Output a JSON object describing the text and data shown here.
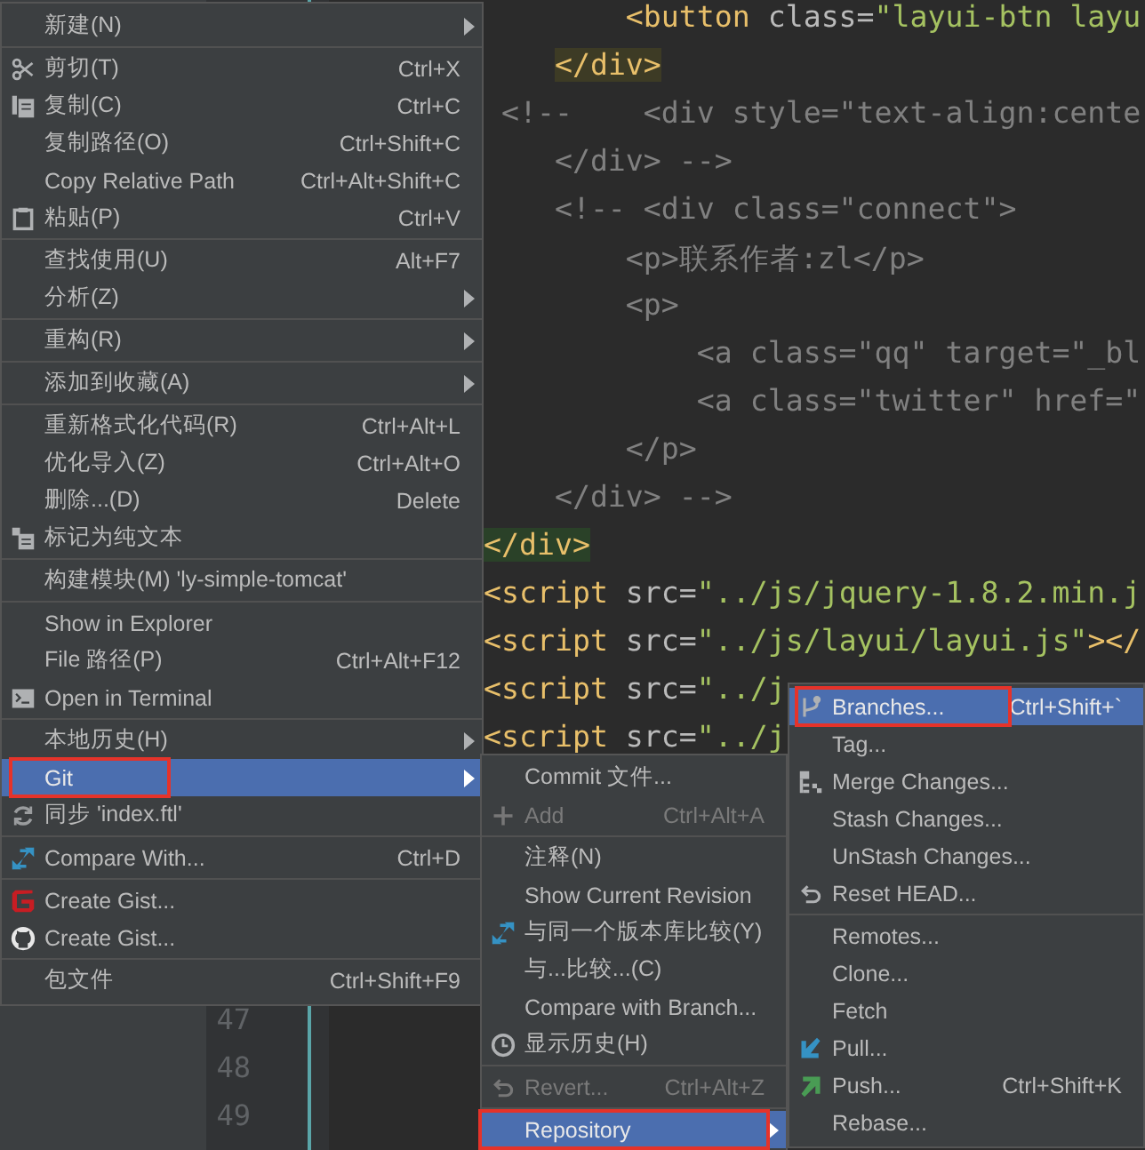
{
  "editor": {
    "code_lines": [
      {
        "tokens": [
          {
            "kind": "tag",
            "text": "        <button"
          },
          {
            "kind": "attr",
            "text": " class="
          },
          {
            "kind": "str",
            "text": "\"layui-btn layu"
          }
        ]
      },
      {
        "tokens": [
          {
            "kind": "matched-tag",
            "text": "    </div>"
          }
        ]
      },
      {
        "tokens": [
          {
            "kind": "comment",
            "text": " <!--    <div style=\"text-align:cente"
          }
        ]
      },
      {
        "tokens": [
          {
            "kind": "comment",
            "text": "    </div> -->"
          }
        ]
      },
      {
        "tokens": [
          {
            "kind": "comment",
            "text": "    <!-- <div class=\"connect\">"
          }
        ]
      },
      {
        "tokens": [
          {
            "kind": "comment",
            "text": "        <p>联系作者:zl</p>"
          }
        ]
      },
      {
        "tokens": [
          {
            "kind": "comment",
            "text": "        <p>"
          }
        ]
      },
      {
        "tokens": [
          {
            "kind": "comment",
            "text": "            <a class=\"qq\" target=\"_bl"
          }
        ]
      },
      {
        "tokens": [
          {
            "kind": "comment",
            "text": "            <a class=\"twitter\" href=\""
          }
        ]
      },
      {
        "tokens": [
          {
            "kind": "comment",
            "text": "        </p>"
          }
        ]
      },
      {
        "tokens": [
          {
            "kind": "comment",
            "text": "    </div> -->"
          }
        ]
      },
      {
        "tokens": [
          {
            "kind": "current-tag",
            "text": "</div>"
          }
        ]
      },
      {
        "tokens": [
          {
            "kind": "tag",
            "text": "<script"
          },
          {
            "kind": "attr",
            "text": " src="
          },
          {
            "kind": "str",
            "text": "\"../js/jquery-1.8.2.min.j"
          }
        ]
      },
      {
        "tokens": [
          {
            "kind": "tag",
            "text": "<script"
          },
          {
            "kind": "attr",
            "text": " src="
          },
          {
            "kind": "str",
            "text": "\"../js/layui/layui.js\""
          },
          {
            "kind": "tag",
            "text": "></"
          }
        ]
      },
      {
        "tokens": [
          {
            "kind": "tag",
            "text": "<script"
          },
          {
            "kind": "attr",
            "text": " src="
          },
          {
            "kind": "str",
            "text": "\"../j"
          }
        ]
      },
      {
        "tokens": [
          {
            "kind": "tag",
            "text": "<script"
          },
          {
            "kind": "attr",
            "text": " src="
          },
          {
            "kind": "str",
            "text": "\"../j"
          }
        ]
      }
    ],
    "line_numbers": [
      "47",
      "48",
      "49"
    ]
  },
  "context_menu": {
    "items": [
      {
        "kind": "item",
        "label": "新建(N)",
        "submenu": true,
        "selected": false,
        "outlined": false
      },
      {
        "kind": "separator"
      },
      {
        "kind": "item",
        "label": "剪切(T)",
        "shortcut": "Ctrl+X",
        "submenu": false,
        "selected": false,
        "outlined": false
      },
      {
        "kind": "item",
        "label": "复制(C)",
        "shortcut": "Ctrl+C",
        "submenu": false,
        "selected": false,
        "outlined": false
      },
      {
        "kind": "item",
        "label": "复制路径(O)",
        "shortcut": "Ctrl+Shift+C",
        "submenu": false,
        "selected": false,
        "outlined": false
      },
      {
        "kind": "item",
        "label": "Copy Relative Path",
        "shortcut": "Ctrl+Alt+Shift+C",
        "submenu": false,
        "selected": false,
        "outlined": false
      },
      {
        "kind": "item",
        "label": "粘贴(P)",
        "shortcut": "Ctrl+V",
        "submenu": false,
        "selected": false,
        "outlined": false
      },
      {
        "kind": "separator"
      },
      {
        "kind": "item",
        "label": "查找使用(U)",
        "shortcut": "Alt+F7",
        "submenu": false,
        "selected": false,
        "outlined": false
      },
      {
        "kind": "item",
        "label": "分析(Z)",
        "submenu": true,
        "selected": false,
        "outlined": false
      },
      {
        "kind": "separator"
      },
      {
        "kind": "item",
        "label": "重构(R)",
        "submenu": true,
        "selected": false,
        "outlined": false
      },
      {
        "kind": "separator"
      },
      {
        "kind": "item",
        "label": "添加到收藏(A)",
        "submenu": true,
        "selected": false,
        "outlined": false
      },
      {
        "kind": "separator"
      },
      {
        "kind": "item",
        "label": "重新格式化代码(R)",
        "shortcut": "Ctrl+Alt+L",
        "submenu": false,
        "selected": false,
        "outlined": false
      },
      {
        "kind": "item",
        "label": "优化导入(Z)",
        "shortcut": "Ctrl+Alt+O",
        "submenu": false,
        "selected": false,
        "outlined": false
      },
      {
        "kind": "item",
        "label": "删除...(D)",
        "shortcut": "Delete",
        "submenu": false,
        "selected": false,
        "outlined": false
      },
      {
        "kind": "item",
        "label": "标记为纯文本",
        "submenu": false,
        "selected": false,
        "outlined": false
      },
      {
        "kind": "separator"
      },
      {
        "kind": "item",
        "label": "构建模块(M) 'ly-simple-tomcat'",
        "submenu": false,
        "selected": false,
        "outlined": false
      },
      {
        "kind": "separator"
      },
      {
        "kind": "item",
        "label": "Show in Explorer",
        "submenu": false,
        "selected": false,
        "outlined": false
      },
      {
        "kind": "item",
        "label": "File 路径(P)",
        "shortcut": "Ctrl+Alt+F12",
        "submenu": false,
        "selected": false,
        "outlined": false
      },
      {
        "kind": "item",
        "label": "Open in Terminal",
        "submenu": false,
        "selected": false,
        "outlined": false
      },
      {
        "kind": "separator"
      },
      {
        "kind": "item",
        "label": "本地历史(H)",
        "submenu": true,
        "selected": false,
        "outlined": false
      },
      {
        "kind": "item",
        "label": "Git",
        "submenu": true,
        "selected": true,
        "outlined": true
      },
      {
        "kind": "item",
        "label": "同步 'index.ftl'",
        "submenu": false,
        "selected": false,
        "outlined": false
      },
      {
        "kind": "separator"
      },
      {
        "kind": "item",
        "label": "Compare With...",
        "shortcut": "Ctrl+D",
        "submenu": false,
        "selected": false,
        "outlined": false
      },
      {
        "kind": "separator"
      },
      {
        "kind": "item",
        "label": "Create Gist...",
        "submenu": false,
        "selected": false,
        "outlined": false
      },
      {
        "kind": "item",
        "label": "Create Gist...",
        "submenu": false,
        "selected": false,
        "outlined": false
      },
      {
        "kind": "separator"
      },
      {
        "kind": "item",
        "label": "包文件",
        "shortcut": "Ctrl+Shift+F9",
        "submenu": false,
        "selected": false,
        "outlined": false
      }
    ]
  },
  "git_submenu": {
    "items": [
      {
        "kind": "item",
        "label": "Commit 文件...",
        "submenu": false,
        "selected": false,
        "disabled": false,
        "outlined": false
      },
      {
        "kind": "item",
        "label": "Add",
        "shortcut": "Ctrl+Alt+A",
        "submenu": false,
        "selected": false,
        "disabled": true,
        "outlined": false
      },
      {
        "kind": "separator"
      },
      {
        "kind": "item",
        "label": "注释(N)",
        "submenu": false,
        "selected": false,
        "disabled": false,
        "outlined": false
      },
      {
        "kind": "item",
        "label": "Show Current Revision",
        "submenu": false,
        "selected": false,
        "disabled": false,
        "outlined": false
      },
      {
        "kind": "item",
        "label": "与同一个版本库比较(Y)",
        "submenu": false,
        "selected": false,
        "disabled": false,
        "outlined": false
      },
      {
        "kind": "item",
        "label": "与...比较...(C)",
        "submenu": false,
        "selected": false,
        "disabled": false,
        "outlined": false
      },
      {
        "kind": "item",
        "label": "Compare with Branch...",
        "submenu": false,
        "selected": false,
        "disabled": false,
        "outlined": false
      },
      {
        "kind": "item",
        "label": "显示历史(H)",
        "submenu": false,
        "selected": false,
        "disabled": false,
        "outlined": false
      },
      {
        "kind": "separator"
      },
      {
        "kind": "item",
        "label": "Revert...",
        "shortcut": "Ctrl+Alt+Z",
        "submenu": false,
        "selected": false,
        "disabled": true,
        "outlined": false
      },
      {
        "kind": "separator"
      },
      {
        "kind": "item",
        "label": "Repository",
        "submenu": true,
        "selected": true,
        "disabled": false,
        "outlined": true
      }
    ]
  },
  "repository_submenu": {
    "items": [
      {
        "kind": "item",
        "label": "Branches...",
        "shortcut": "Ctrl+Shift+`",
        "submenu": false,
        "selected": true,
        "outlined": true
      },
      {
        "kind": "item",
        "label": "Tag...",
        "submenu": false,
        "selected": false,
        "outlined": false
      },
      {
        "kind": "item",
        "label": "Merge Changes...",
        "submenu": false,
        "selected": false,
        "outlined": false
      },
      {
        "kind": "item",
        "label": "Stash Changes...",
        "submenu": false,
        "selected": false,
        "outlined": false
      },
      {
        "kind": "item",
        "label": "UnStash Changes...",
        "submenu": false,
        "selected": false,
        "outlined": false
      },
      {
        "kind": "item",
        "label": "Reset HEAD...",
        "submenu": false,
        "selected": false,
        "outlined": false
      },
      {
        "kind": "separator"
      },
      {
        "kind": "item",
        "label": "Remotes...",
        "submenu": false,
        "selected": false,
        "outlined": false
      },
      {
        "kind": "item",
        "label": "Clone...",
        "submenu": false,
        "selected": false,
        "outlined": false
      },
      {
        "kind": "item",
        "label": "Fetch",
        "submenu": false,
        "selected": false,
        "outlined": false
      },
      {
        "kind": "item",
        "label": "Pull...",
        "submenu": false,
        "selected": false,
        "outlined": false
      },
      {
        "kind": "item",
        "label": "Push...",
        "shortcut": "Ctrl+Shift+K",
        "submenu": false,
        "selected": false,
        "outlined": false
      },
      {
        "kind": "item",
        "label": "Rebase...",
        "submenu": false,
        "selected": false,
        "outlined": false
      }
    ]
  }
}
